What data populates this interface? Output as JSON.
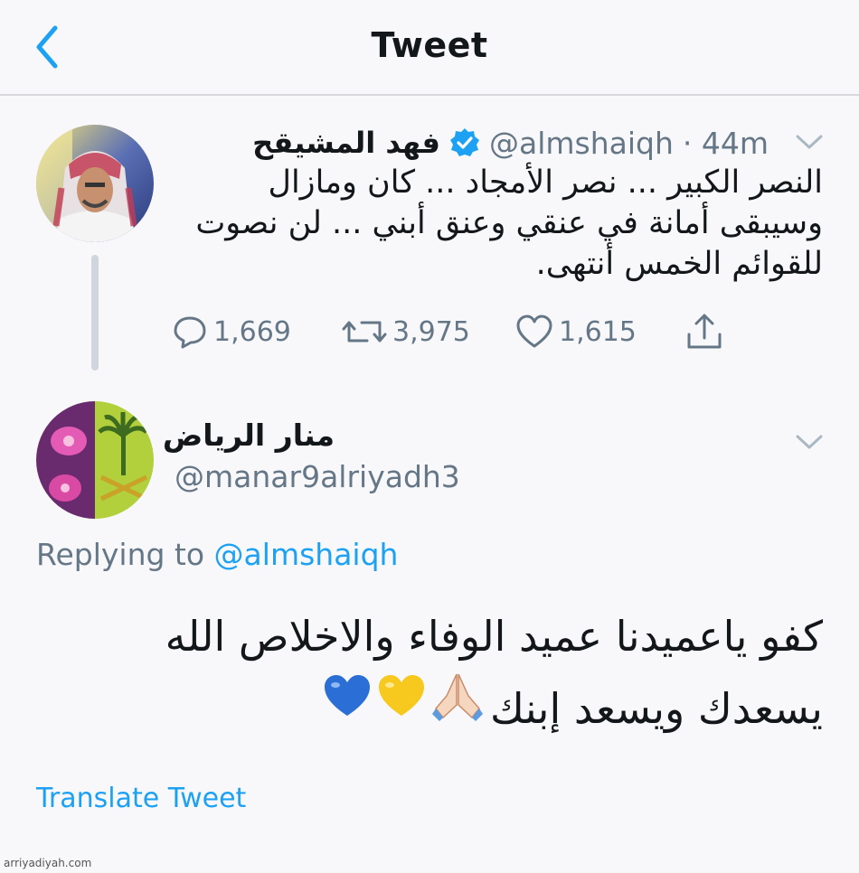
{
  "header": {
    "title": "Tweet"
  },
  "parent_tweet": {
    "name": "فهد المشيقح",
    "handle": "@almshaiqh",
    "time": "· 44m",
    "verified": true,
    "text_lines": [
      "النصر الكبير ...  نصر الأمجاد ... كان ومازال",
      "وسيبقى أمانة في عنقي وعنق أبني ... لن نصوت",
      "للقوائم  الخمس أنتهى."
    ],
    "replies": "1,669",
    "retweets": "3,975",
    "likes": "1,615"
  },
  "reply_tweet": {
    "name": "منار الرياض",
    "handle": "@manar9alriyadh3",
    "replying_prefix": "Replying to",
    "replying_to": "@almshaiqh",
    "text_lines": [
      "كفو ياعميدنا عميد الوفاء والاخلاص الله",
      "يسعدك ويسعد إبنك"
    ],
    "emojis": [
      "praying-hands",
      "yellow-heart",
      "blue-heart"
    ],
    "translate_label": "Translate Tweet"
  },
  "watermark": "arriyadiyah.com",
  "colors": {
    "accent": "#1da1f2",
    "muted": "#657786",
    "text": "#14171a",
    "background": "#f8f8fa"
  }
}
